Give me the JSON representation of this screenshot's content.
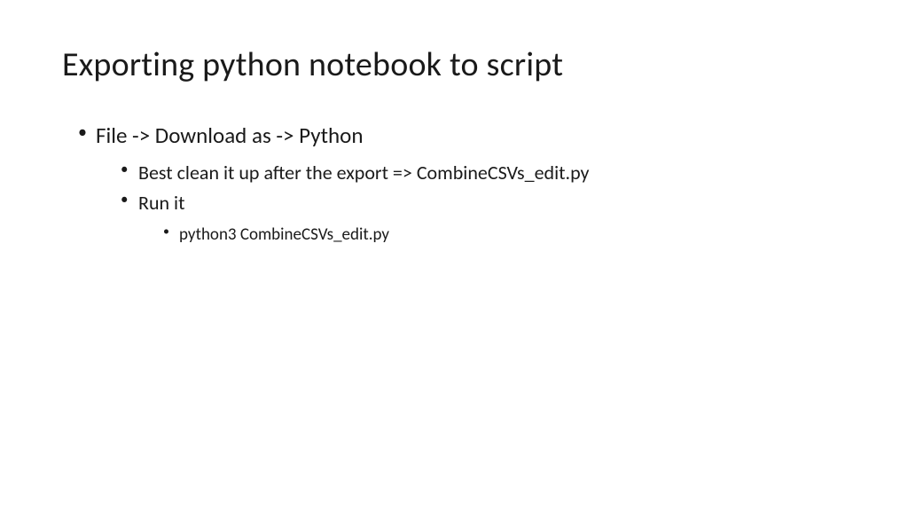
{
  "slide": {
    "title": "Exporting python notebook to script",
    "bullets": {
      "l1_item1": "File -> Download as -> Python",
      "l2_item1": "Best clean it up after the export =>   CombineCSVs_edit.py",
      "l2_item2": "Run it",
      "l3_item1": "python3  CombineCSVs_edit.py"
    }
  }
}
